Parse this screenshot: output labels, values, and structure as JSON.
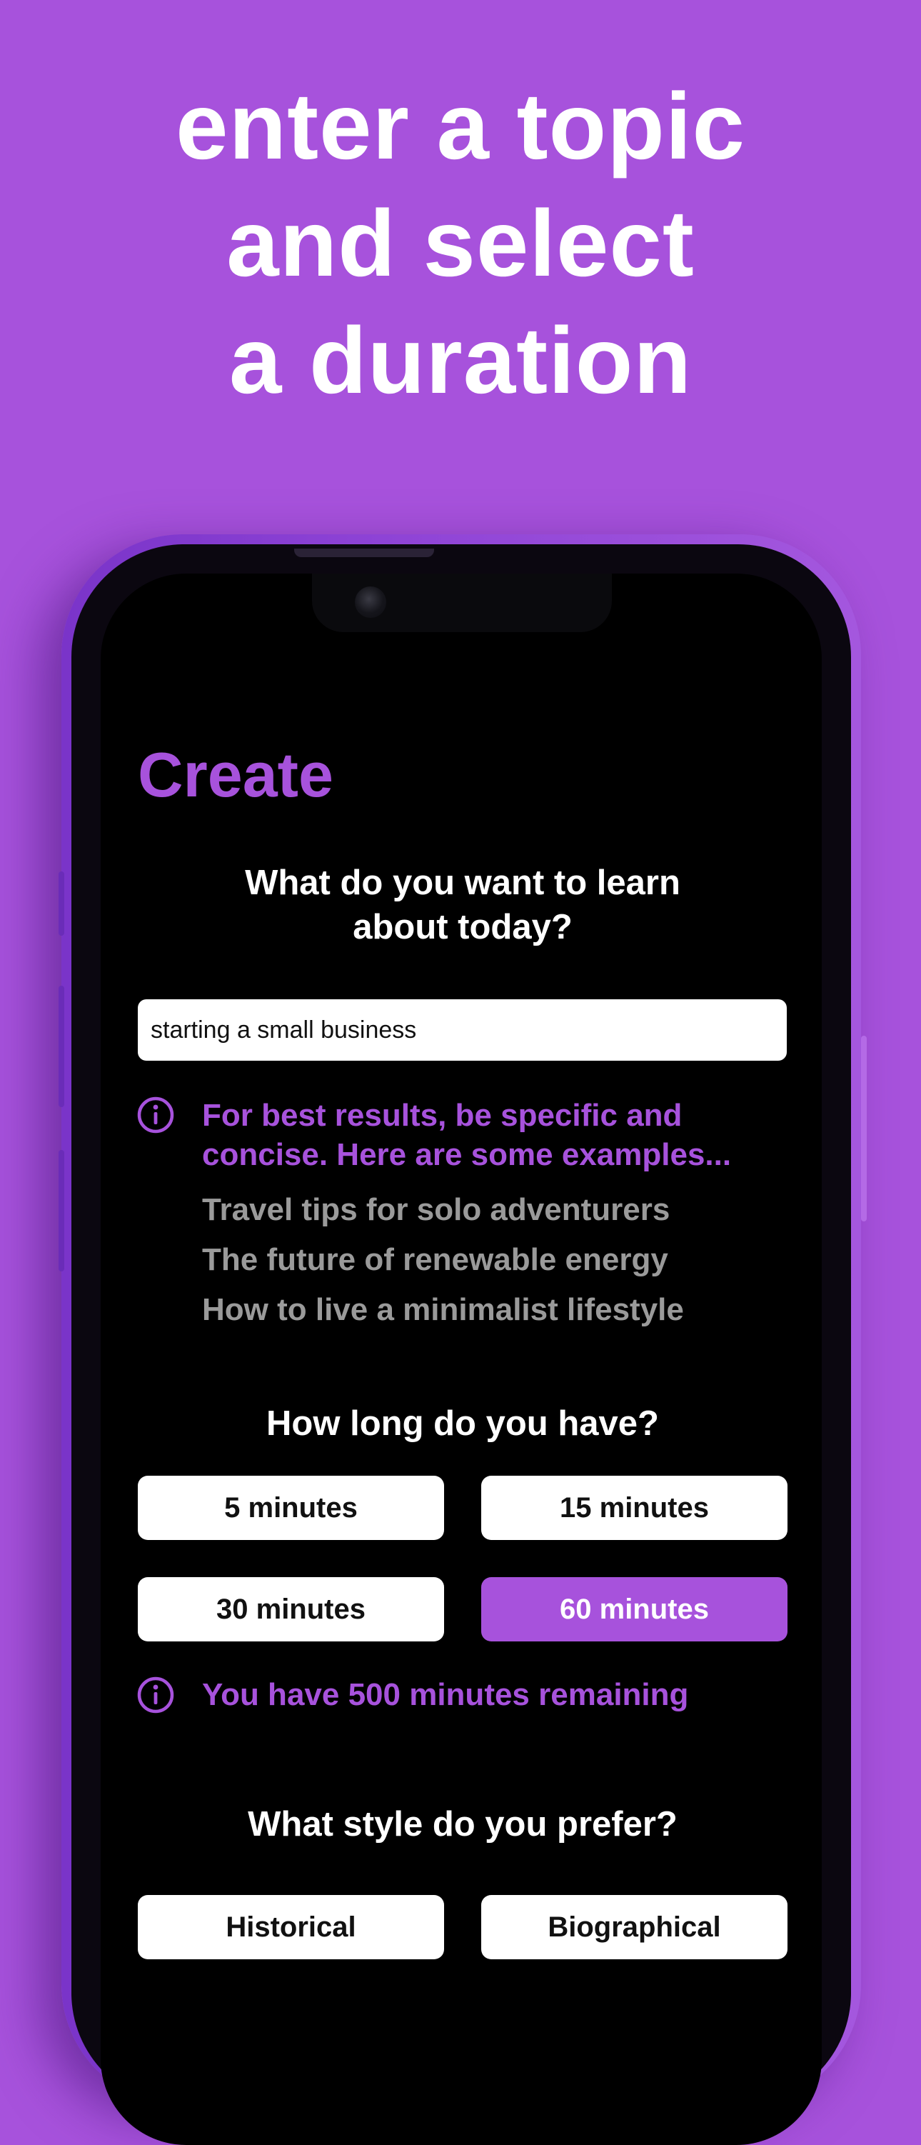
{
  "headline": {
    "line1": "enter a topic",
    "line2": "and select",
    "line3": "a duration"
  },
  "screen": {
    "title": "Create",
    "topic_question_line1": "What do you want to learn",
    "topic_question_line2": "about today?",
    "topic_input_value": "starting a small business",
    "tip_line1": "For best results, be specific and",
    "tip_line2": "concise. Here are some examples...",
    "examples": [
      "Travel tips for solo adventurers",
      "The future of renewable energy",
      "How to live a minimalist lifestyle"
    ],
    "duration_question": "How long do you have?",
    "durations": [
      {
        "label": "5 minutes",
        "selected": false
      },
      {
        "label": "15 minutes",
        "selected": false
      },
      {
        "label": "30 minutes",
        "selected": false
      },
      {
        "label": "60 minutes",
        "selected": true
      }
    ],
    "remaining_text": "You have 500 minutes remaining",
    "style_question": "What style do you prefer?",
    "styles": [
      {
        "label": "Historical"
      },
      {
        "label": "Biographical"
      }
    ]
  },
  "colors": {
    "background": "#A752DC",
    "accent": "#A752DC",
    "screen": "#000000",
    "button": "#FFFFFF",
    "muted_text": "#9A9A9A"
  },
  "icons": [
    "info-icon",
    "camera-icon"
  ]
}
